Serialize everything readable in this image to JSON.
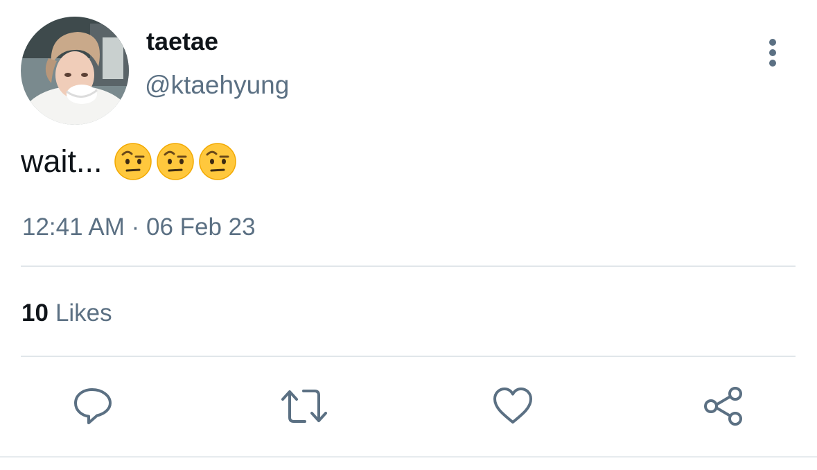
{
  "author": {
    "display_name": "taetae",
    "handle": "@ktaehyung",
    "avatar": "profile-photo"
  },
  "tweet": {
    "text": "wait...",
    "emojis": [
      "face-with-raised-eyebrow",
      "face-with-raised-eyebrow",
      "face-with-raised-eyebrow"
    ],
    "timestamp": "12:41 AM · 06 Feb 23"
  },
  "stats": {
    "likes_count": "10",
    "likes_label": "Likes"
  },
  "actions": [
    {
      "name": "reply",
      "icon": "speech-bubble-icon"
    },
    {
      "name": "retweet",
      "icon": "retweet-arrows-icon"
    },
    {
      "name": "like",
      "icon": "heart-icon"
    },
    {
      "name": "share",
      "icon": "share-nodes-icon"
    }
  ],
  "colors": {
    "text_primary": "#0f1419",
    "text_secondary": "#5b7083",
    "divider": "#e1e6ea",
    "emoji_face": "#ffc83d"
  }
}
